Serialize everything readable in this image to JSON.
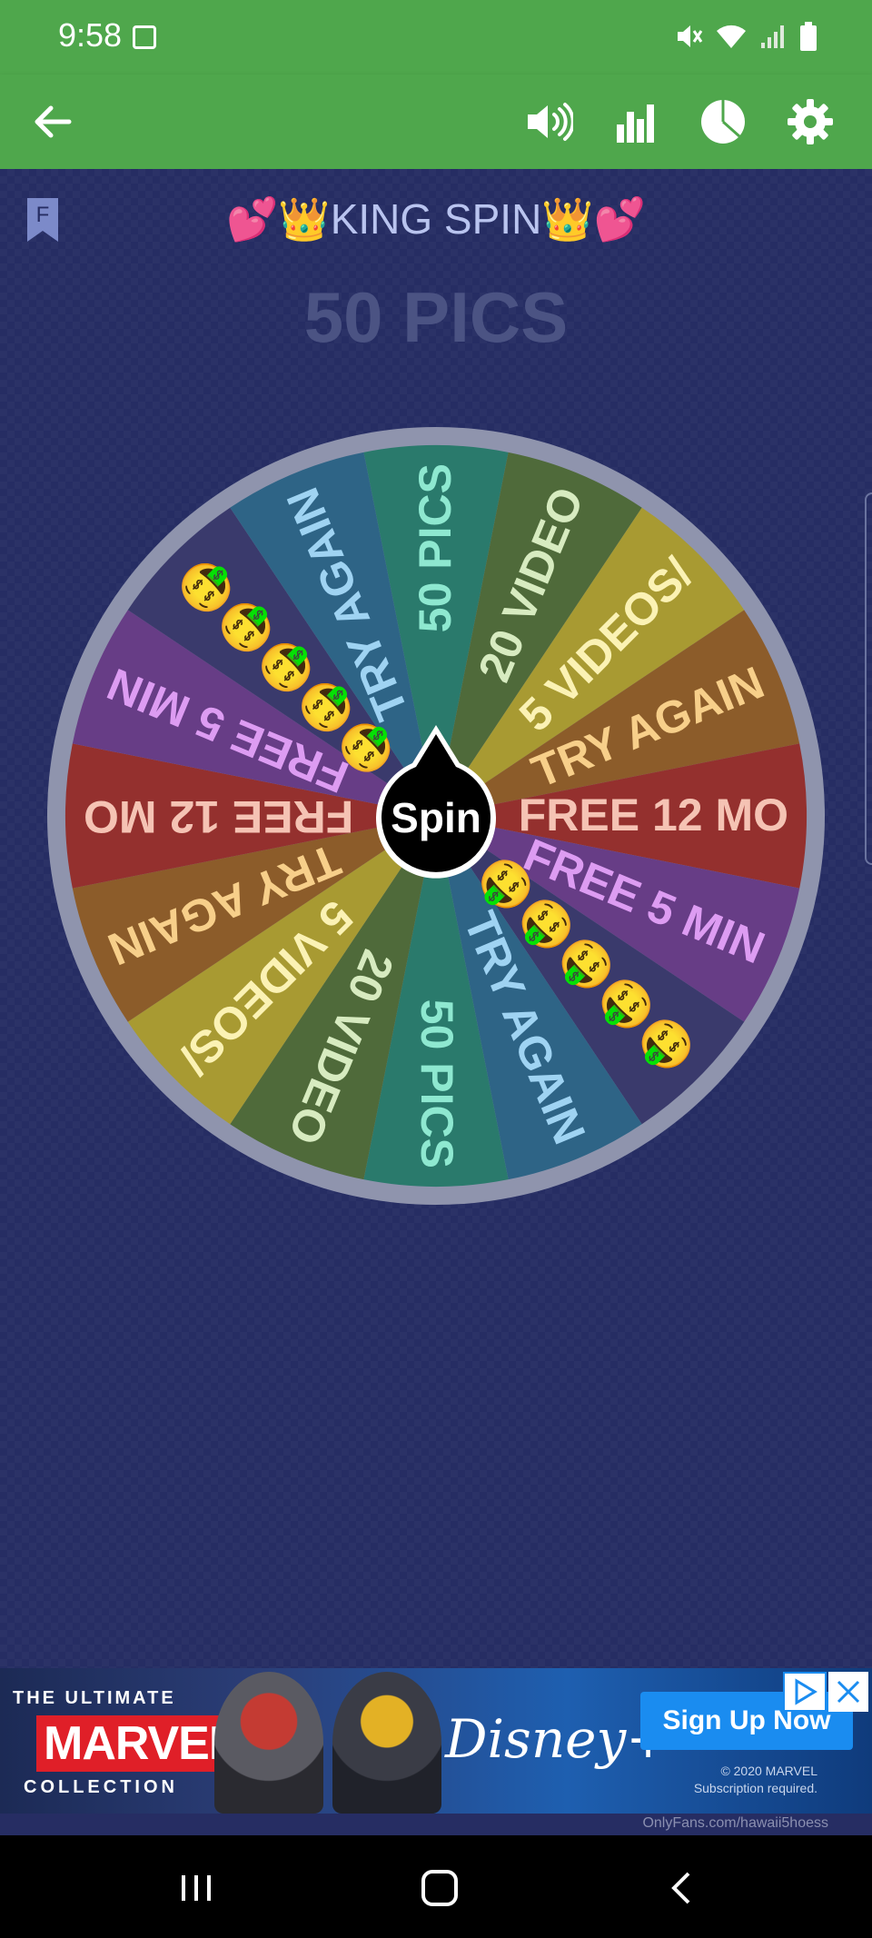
{
  "status_bar": {
    "time": "9:58"
  },
  "app_bar": {
    "icons": [
      "back-arrow-icon",
      "volume-icon",
      "bar-chart-icon",
      "pie-chart-icon",
      "settings-gear-icon"
    ]
  },
  "bookmark": {
    "letter": "F"
  },
  "wheel": {
    "title": "💕👑KING SPIN👑💕",
    "result": "50 PICS",
    "spin_label": "Spin",
    "slices": [
      {
        "label": "50 PICS",
        "color": "#2a7a6c",
        "text_color": "#8ee8d0"
      },
      {
        "label": "20 VIDEO",
        "color": "#4f6a3a",
        "text_color": "#d7ebc0"
      },
      {
        "label": "5 VIDEOS/",
        "color": "#a89a32",
        "text_color": "#fbf2b4"
      },
      {
        "label": "TRY AGAIN",
        "color": "#8c5c2a",
        "text_color": "#f7cf8a"
      },
      {
        "label": "FREE 12 MO",
        "color": "#94302e",
        "text_color": "#f5c3b4"
      },
      {
        "label": "FREE 5 MIN",
        "color": "#673d86",
        "text_color": "#dd9cf2"
      },
      {
        "label": "🤑🤑🤑🤑🤑",
        "color": "#3a3a6c",
        "text_color": "#ffffff"
      },
      {
        "label": "TRY AGAIN",
        "color": "#2e6486",
        "text_color": "#9fd3f2"
      },
      {
        "label": "50 PICS",
        "color": "#2a7a6c",
        "text_color": "#8ee8d0"
      },
      {
        "label": "20 VIDEO",
        "color": "#4f6a3a",
        "text_color": "#d7ebc0"
      },
      {
        "label": "5 VIDEOS/",
        "color": "#a89a32",
        "text_color": "#fbf2b4"
      },
      {
        "label": "TRY AGAIN",
        "color": "#8c5c2a",
        "text_color": "#f7cf8a"
      },
      {
        "label": "FREE 12 MO",
        "color": "#94302e",
        "text_color": "#f5c3b4"
      },
      {
        "label": "FREE 5 MIN",
        "color": "#673d86",
        "text_color": "#dd9cf2"
      },
      {
        "label": "🤑🤑🤑🤑🤑",
        "color": "#3a3a6c",
        "text_color": "#ffffff"
      },
      {
        "label": "TRY AGAIN",
        "color": "#2e6486",
        "text_color": "#9fd3f2"
      }
    ]
  },
  "ad": {
    "ultimate": "THE ULTIMATE",
    "marvel": "MARVEL",
    "collection": "COLLECTION",
    "disney": "Disney+",
    "cta": "Sign Up Now",
    "copyright_line1": "© 2020 MARVEL",
    "copyright_line2": "Subscription required."
  },
  "watermark": "OnlyFans.com/hawaii5hoess",
  "nav_bar": {
    "icons": [
      "recents-icon",
      "home-icon",
      "back-icon"
    ]
  },
  "colors": {
    "app_bar": "#4fa74c",
    "background": "#262d63",
    "accent_blue": "#1a8cf0"
  }
}
